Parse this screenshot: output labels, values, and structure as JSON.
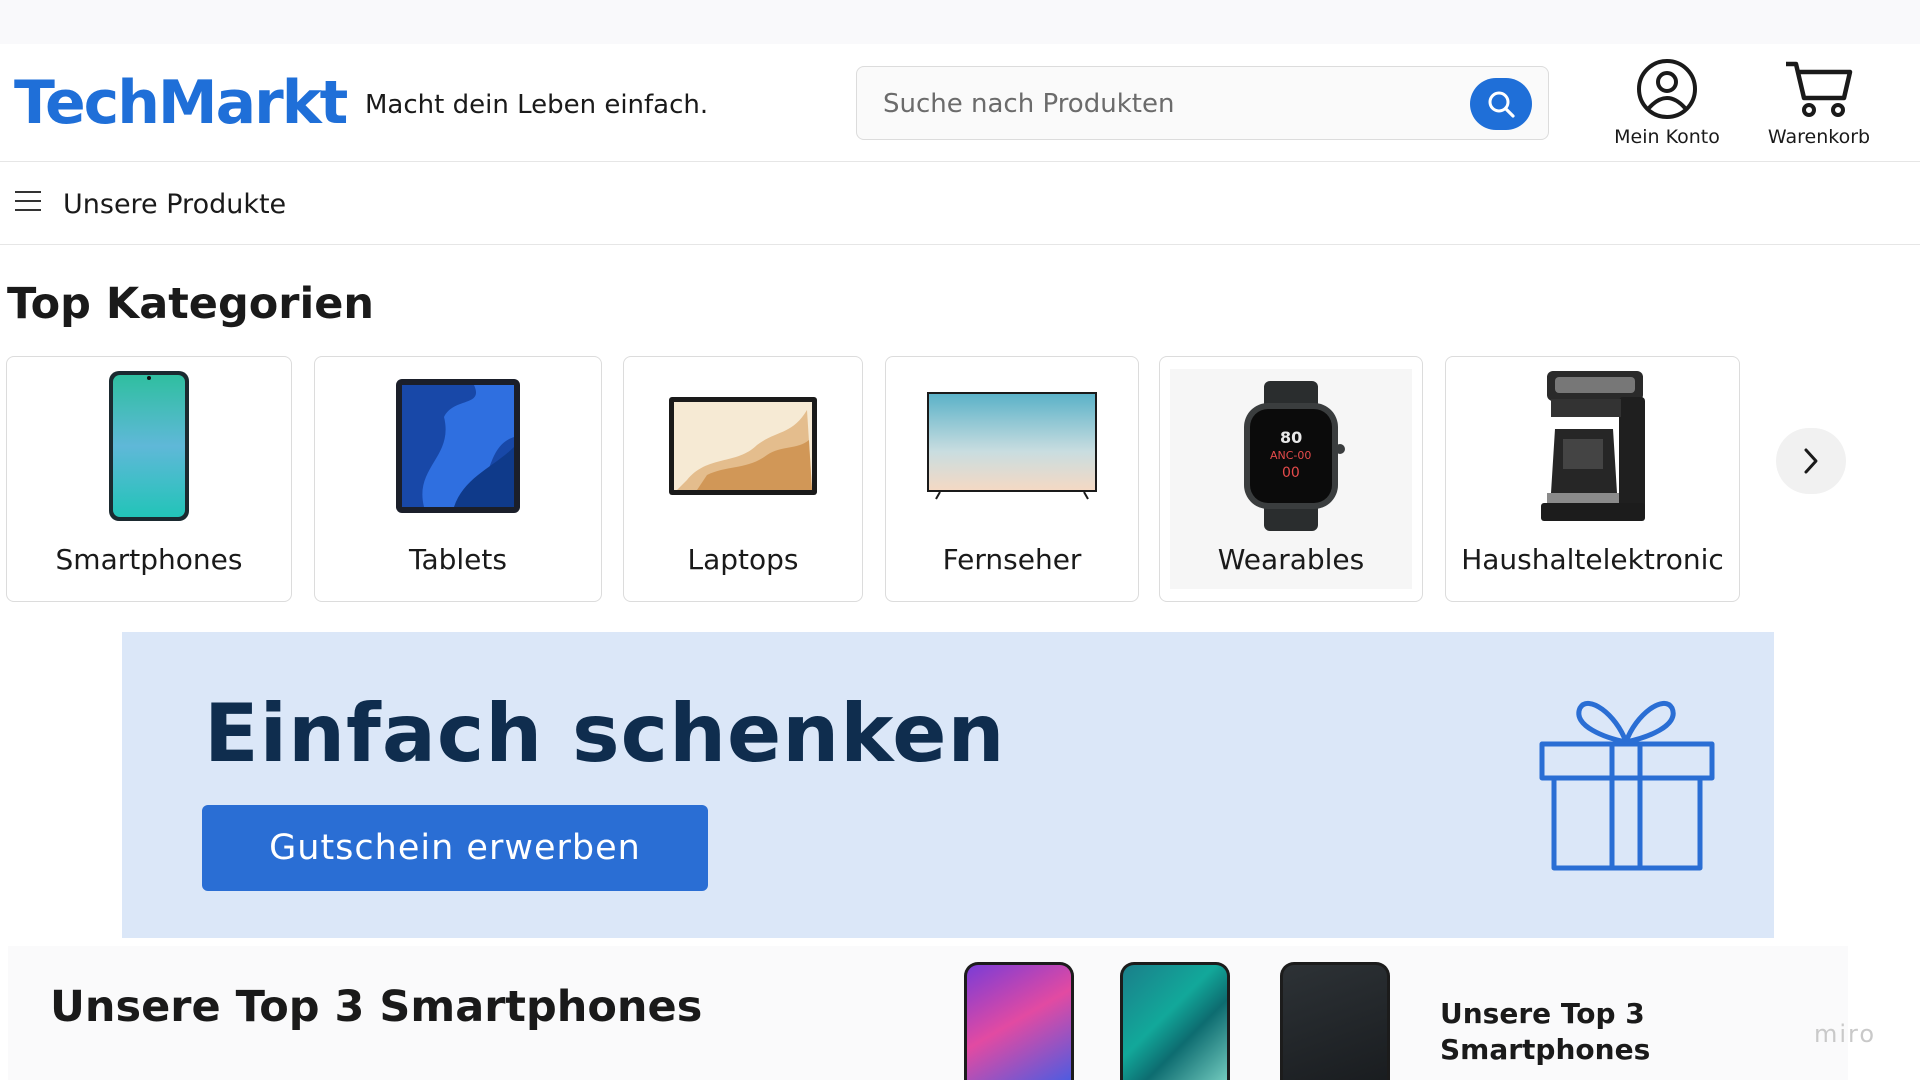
{
  "header": {
    "logo": "TechMarkt",
    "tagline": "Macht dein Leben einfach.",
    "search_placeholder": "Suche nach Produkten",
    "account_label": "Mein Konto",
    "cart_label": "Warenkorb",
    "icons": {
      "search": "search-icon",
      "account": "user-circle-icon",
      "cart": "shopping-cart-icon"
    },
    "colors": {
      "brand": "#1f6fd8"
    }
  },
  "nav": {
    "menu_label": "Unsere Produkte",
    "icon": "hamburger-menu-icon"
  },
  "categories": {
    "title": "Top Kategorien",
    "items": [
      {
        "label": "Smartphones"
      },
      {
        "label": "Tablets"
      },
      {
        "label": "Laptops"
      },
      {
        "label": "Fernseher"
      },
      {
        "label": "Wearables",
        "watch_display": [
          "80",
          "ANC-00",
          "00"
        ]
      },
      {
        "label": "Haushaltelektronic"
      }
    ],
    "next_icon": "chevron-right-icon"
  },
  "banner": {
    "title": "Einfach schenken",
    "button_label": "Gutschein erwerben",
    "icon": "gift-icon",
    "colors": {
      "background": "#dbe7f8",
      "button": "#2a6ed4",
      "title": "#0f2d4e"
    }
  },
  "top3": {
    "title": "Unsere Top 3 Smartphones",
    "side_text": "Unsere Top 3 Smartphones"
  },
  "watermark": "miro"
}
